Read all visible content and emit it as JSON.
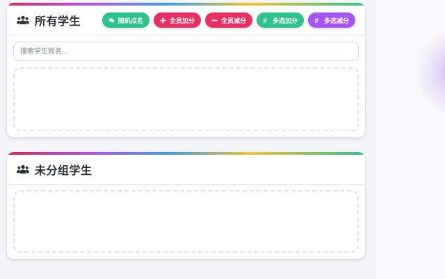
{
  "all_students": {
    "title": "所有学生",
    "icon": "users-icon",
    "buttons": [
      {
        "label": "随机点名",
        "color": "#2bc48a",
        "icon": "chat-bubble-icon"
      },
      {
        "label": "全员加分",
        "color": "#ea2f63",
        "icon": "plus-icon"
      },
      {
        "label": "全员减分",
        "color": "#ea2f63",
        "icon": "minus-icon"
      },
      {
        "label": "多选加分",
        "color": "#2bc48a",
        "icon": "double-check-icon"
      },
      {
        "label": "多选减分",
        "color": "#a855f7",
        "icon": "double-check-icon"
      }
    ],
    "search": {
      "placeholder": "搜索学生姓名...",
      "value": ""
    }
  },
  "ungrouped_students": {
    "title": "未分组学生",
    "icon": "users-icon"
  },
  "colors": {
    "accent_green": "#2bc48a",
    "accent_red": "#ea2f63",
    "accent_purple": "#a855f7",
    "title_text": "#2b2f36"
  }
}
